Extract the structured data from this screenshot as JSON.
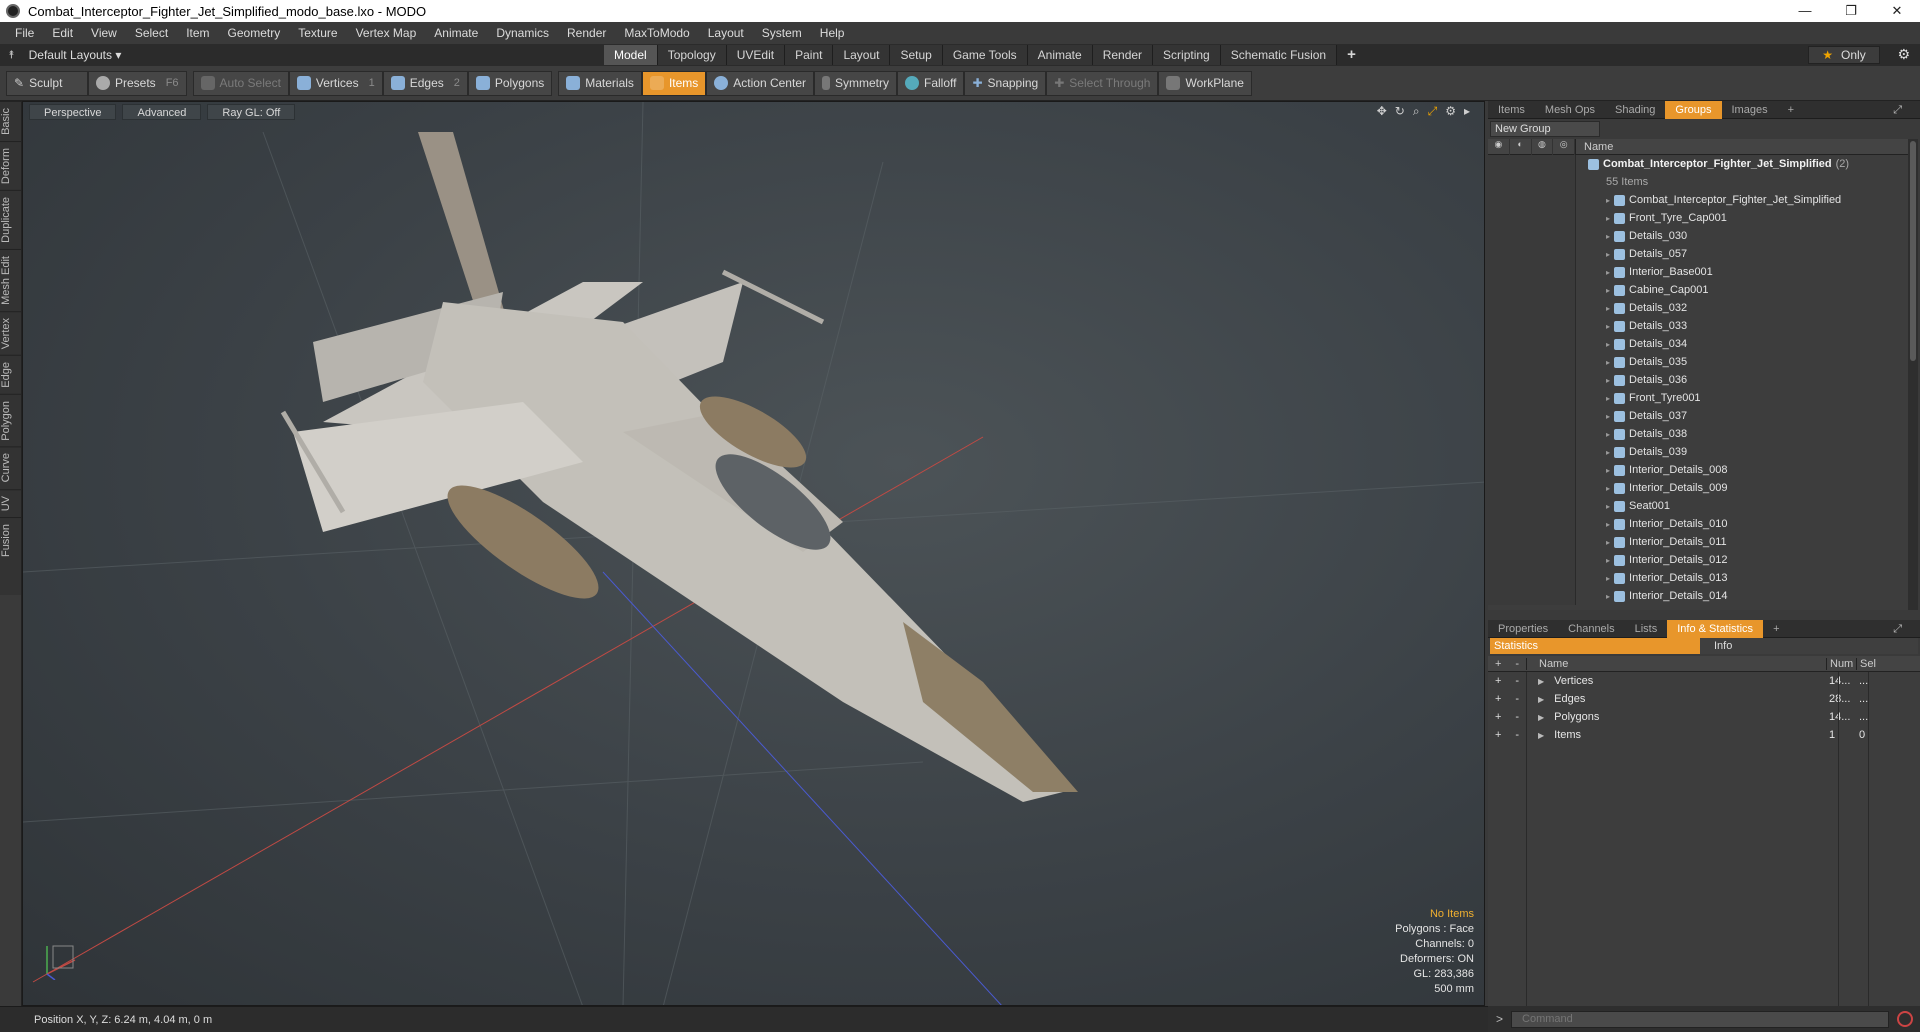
{
  "window": {
    "title": "Combat_Interceptor_Fighter_Jet_Simplified_modo_base.lxo - MODO",
    "minimize": "—",
    "maximize": "❐",
    "close": "✕"
  },
  "menu": [
    "File",
    "Edit",
    "View",
    "Select",
    "Item",
    "Geometry",
    "Texture",
    "Vertex Map",
    "Animate",
    "Dynamics",
    "Render",
    "MaxToModo",
    "Layout",
    "System",
    "Help"
  ],
  "layout": {
    "label": "Default Layouts ▾",
    "tabs": [
      "Model",
      "Topology",
      "UVEdit",
      "Paint",
      "Layout",
      "Setup",
      "Game Tools",
      "Animate",
      "Render",
      "Scripting",
      "Schematic Fusion"
    ],
    "active_tab": "Model",
    "only": "Only"
  },
  "toolbar": {
    "sculpt": "Sculpt",
    "presets": "Presets",
    "presets_key": "F6",
    "auto_select": "Auto Select",
    "vertices": "Vertices",
    "vertices_n": "1",
    "edges": "Edges",
    "edges_n": "2",
    "polygons": "Polygons",
    "materials": "Materials",
    "items": "Items",
    "action_center": "Action Center",
    "symmetry": "Symmetry",
    "falloff": "Falloff",
    "snapping": "Snapping",
    "select_through": "Select Through",
    "workplane": "WorkPlane"
  },
  "left_tabs": [
    "Basic",
    "Deform",
    "Duplicate",
    "Mesh Edit",
    "Vertex",
    "Edge",
    "Polygon",
    "Curve",
    "UV",
    "Fusion"
  ],
  "viewport": {
    "view": "Perspective",
    "shading": "Advanced",
    "raygl": "Ray GL: Off",
    "stats": {
      "no_items": "No Items",
      "polygons": "Polygons : Face",
      "channels": "Channels: 0",
      "deformers": "Deformers: ON",
      "gl": "GL: 283,386",
      "scale": "500 mm"
    }
  },
  "status": {
    "position": "Position X, Y, Z:   6.24 m, 4.04 m, 0 m"
  },
  "panel_top": {
    "tabs": [
      "Items",
      "Mesh Ops",
      "Shading",
      "Groups",
      "Images"
    ],
    "active": "Groups",
    "new_group": "New Group",
    "name_col": "Name",
    "group_name": "Combat_Interceptor_Fighter_Jet_Simplified",
    "group_count": "(2)",
    "group_sub": "55 Items",
    "items": [
      "Combat_Interceptor_Fighter_Jet_Simplified",
      "Front_Tyre_Cap001",
      "Details_030",
      "Details_057",
      "Interior_Base001",
      "Cabine_Cap001",
      "Details_032",
      "Details_033",
      "Details_034",
      "Details_035",
      "Details_036",
      "Front_Tyre001",
      "Details_037",
      "Details_038",
      "Details_039",
      "Interior_Details_008",
      "Interior_Details_009",
      "Seat001",
      "Interior_Details_010",
      "Interior_Details_011",
      "Interior_Details_012",
      "Interior_Details_013",
      "Interior_Details_014"
    ]
  },
  "panel_bottom": {
    "tabs": [
      "Properties",
      "Channels",
      "Lists",
      "Info & Statistics"
    ],
    "active": "Info & Statistics",
    "statistics": "Statistics",
    "info": "Info",
    "head": {
      "name": "Name",
      "num": "Num",
      "sel": "Sel"
    },
    "rows": [
      {
        "name": "Vertices",
        "num": "14...",
        "sel": "..."
      },
      {
        "name": "Edges",
        "num": "28...",
        "sel": "..."
      },
      {
        "name": "Polygons",
        "num": "14...",
        "sel": "..."
      },
      {
        "name": "Items",
        "num": "1",
        "sel": "0"
      }
    ]
  },
  "command": {
    "placeholder": "Command"
  },
  "colors": {
    "accent": "#e8962b"
  }
}
